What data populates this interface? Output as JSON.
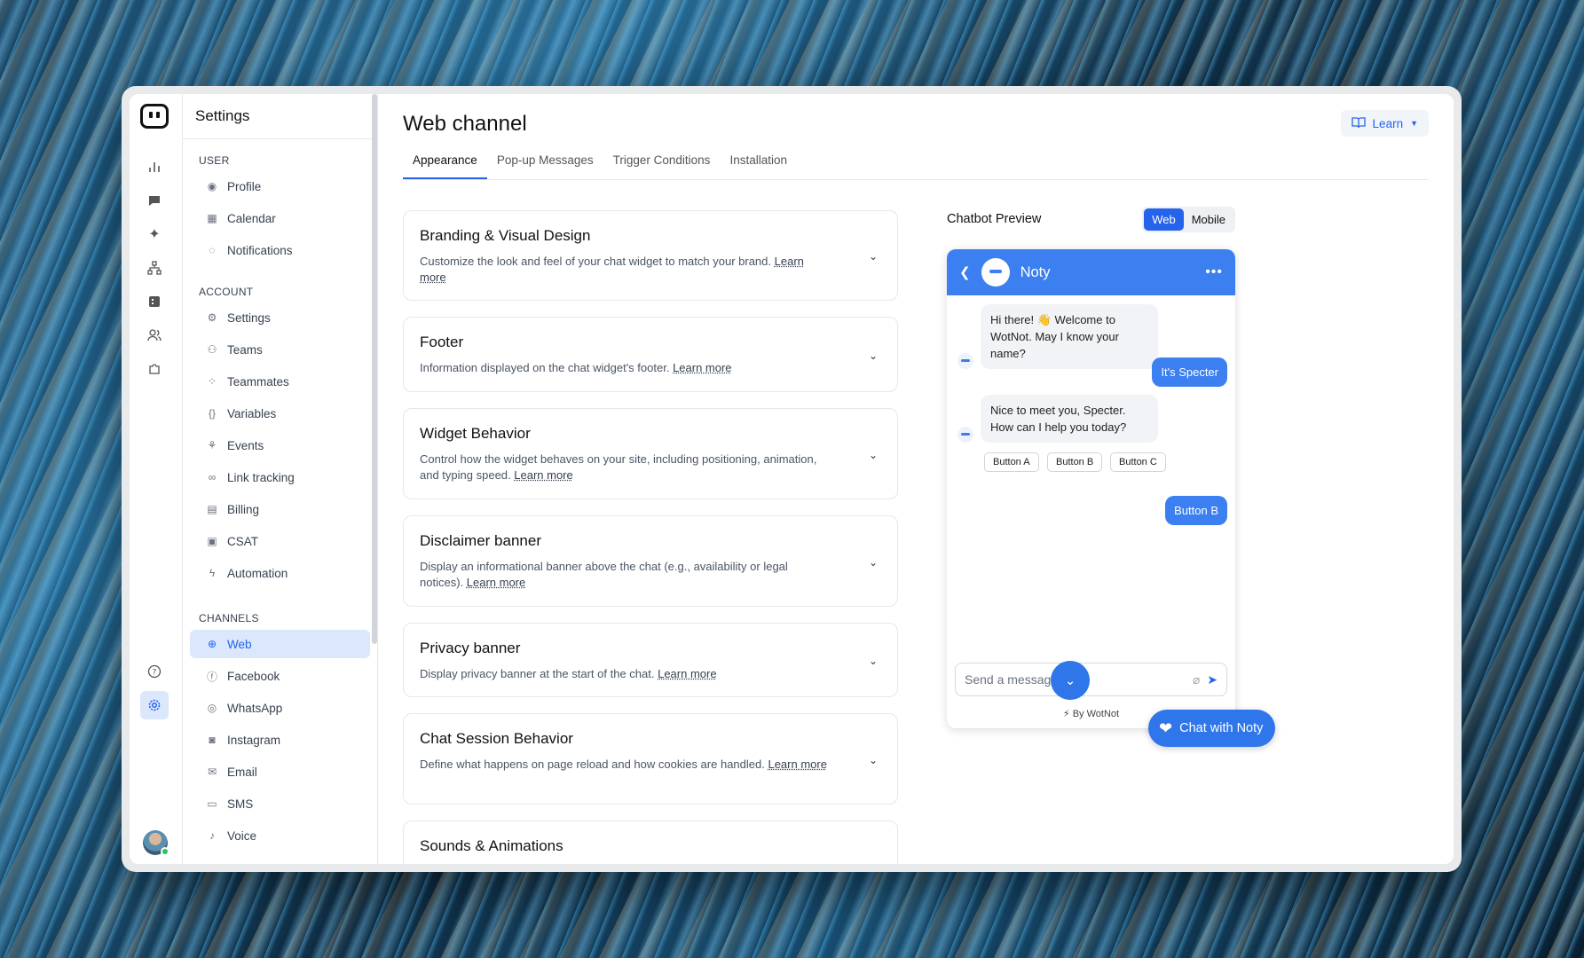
{
  "side": {
    "title": "Settings",
    "user_label": "USER",
    "user_items": [
      {
        "label": "Profile",
        "icon": "user-circle-icon"
      },
      {
        "label": "Calendar",
        "icon": "calendar-icon"
      },
      {
        "label": "Notifications",
        "icon": "bell-icon"
      }
    ],
    "account_label": "ACCOUNT",
    "account_items": [
      {
        "label": "Settings",
        "icon": "gear-icon"
      },
      {
        "label": "Teams",
        "icon": "users-icon"
      },
      {
        "label": "Teammates",
        "icon": "grid-users-icon"
      },
      {
        "label": "Variables",
        "icon": "braces-icon"
      },
      {
        "label": "Events",
        "icon": "events-icon"
      },
      {
        "label": "Link tracking",
        "icon": "link-icon"
      },
      {
        "label": "Billing",
        "icon": "billing-icon"
      },
      {
        "label": "CSAT",
        "icon": "csat-icon"
      },
      {
        "label": "Automation",
        "icon": "bolt-icon"
      }
    ],
    "channels_label": "CHANNELS",
    "channel_items": [
      {
        "label": "Web",
        "icon": "globe-icon"
      },
      {
        "label": "Facebook",
        "icon": "facebook-icon"
      },
      {
        "label": "WhatsApp",
        "icon": "whatsapp-icon"
      },
      {
        "label": "Instagram",
        "icon": "instagram-icon"
      },
      {
        "label": "Email",
        "icon": "mail-icon"
      },
      {
        "label": "SMS",
        "icon": "sms-icon"
      },
      {
        "label": "Voice",
        "icon": "mic-icon"
      }
    ]
  },
  "main": {
    "title": "Web channel",
    "learn_label": "Learn",
    "tabs": [
      "Appearance",
      "Pop-up Messages",
      "Trigger Conditions",
      "Installation"
    ],
    "cards": [
      {
        "title": "Branding & Visual Design",
        "desc": "Customize the look and feel of your chat widget to match your brand.",
        "link": "Learn more"
      },
      {
        "title": "Footer",
        "desc": "Information displayed on the chat widget's footer.",
        "link": "Learn more"
      },
      {
        "title": "Widget Behavior",
        "desc": "Control how the widget behaves on your site, including positioning, animation, and typing speed.",
        "link": "Learn more"
      },
      {
        "title": "Disclaimer banner",
        "desc": "Display an informational banner above the chat (e.g., availability or legal notices).",
        "link": "Learn more"
      },
      {
        "title": "Privacy banner",
        "desc": "Display privacy banner at the start of the chat.",
        "link": "Learn more"
      },
      {
        "title": "Chat Session Behavior",
        "desc": "Define what happens on page reload and how cookies are handled.",
        "link": "Learn more"
      },
      {
        "title": "Sounds & Animations",
        "desc": "",
        "link": ""
      }
    ]
  },
  "preview": {
    "label": "Chatbot Preview",
    "seg": [
      "Web",
      "Mobile"
    ],
    "bot_name": "Noty",
    "msg1": "Hi there! 👋 Welcome to WotNot. May I know your name?",
    "reply1": "It's Specter",
    "msg2": "Nice to meet you, Specter. How can I help you today?",
    "buttons": [
      "Button A",
      "Button B",
      "Button C"
    ],
    "reply2": "Button B",
    "input_placeholder": "Send a message",
    "powered": "⚡ By WotNot"
  },
  "chat_fab_label": "Chat with Noty",
  "colors": {
    "accent": "#2563eb",
    "header": "#3b7ff0"
  }
}
